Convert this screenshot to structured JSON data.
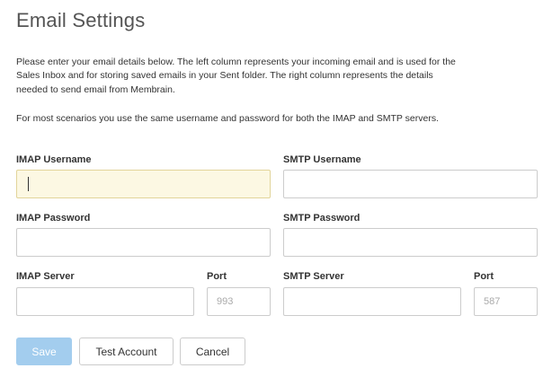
{
  "page": {
    "title": "Email Settings",
    "intro_1": "Please enter your email details below. The left column represents your incoming email and is used for the Sales Inbox and for storing saved emails in your Sent folder. The right column represents the details needed to send email from Membrain.",
    "intro_2": "For most scenarios you use the same username and password for both the IMAP and SMTP servers."
  },
  "imap": {
    "username_label": "IMAP Username",
    "username_value": "",
    "password_label": "IMAP Password",
    "password_value": "",
    "server_label": "IMAP Server",
    "server_value": "",
    "port_label": "Port",
    "port_placeholder": "993"
  },
  "smtp": {
    "username_label": "SMTP Username",
    "username_value": "",
    "password_label": "SMTP Password",
    "password_value": "",
    "server_label": "SMTP Server",
    "server_value": "",
    "port_label": "Port",
    "port_placeholder": "587"
  },
  "buttons": {
    "save": "Save",
    "test_account": "Test Account",
    "cancel": "Cancel"
  },
  "colors": {
    "focused_field_bg": "#fcf8e3",
    "save_button_bg": "#a3cdee"
  }
}
